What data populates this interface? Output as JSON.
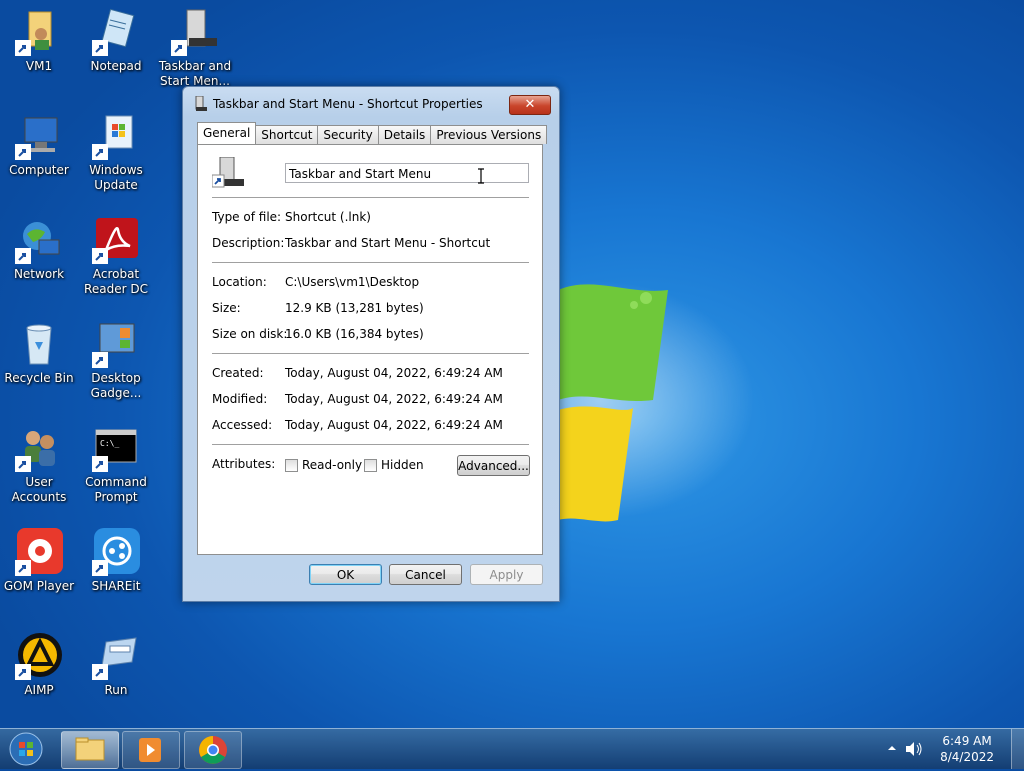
{
  "desktop": {
    "icons": [
      {
        "label": "VM1",
        "name": "vm1-folder"
      },
      {
        "label": "Notepad",
        "name": "notepad"
      },
      {
        "label": "Taskbar and Start Men...",
        "name": "taskbar-and-start-menu"
      },
      {
        "label": "Computer",
        "name": "computer"
      },
      {
        "label": "Windows Update",
        "name": "windows-update"
      },
      {
        "label": "Network",
        "name": "network"
      },
      {
        "label": "Acrobat Reader DC",
        "name": "acrobat-reader-dc"
      },
      {
        "label": "Recycle Bin",
        "name": "recycle-bin"
      },
      {
        "label": "Desktop Gadge...",
        "name": "desktop-gadgets"
      },
      {
        "label": "User Accounts",
        "name": "user-accounts"
      },
      {
        "label": "Command Prompt",
        "name": "command-prompt"
      },
      {
        "label": "GOM Player",
        "name": "gom-player"
      },
      {
        "label": "SHAREit",
        "name": "shareit"
      },
      {
        "label": "AIMP",
        "name": "aimp"
      },
      {
        "label": "Run",
        "name": "run"
      }
    ]
  },
  "dialog": {
    "title": "Taskbar and Start Menu - Shortcut Properties",
    "close_label": "✕",
    "tabs": [
      "General",
      "Shortcut",
      "Security",
      "Details",
      "Previous Versions"
    ],
    "active_tab": "General",
    "name_value": "Taskbar and Start Menu",
    "type_label": "Type of file:",
    "type_value": "Shortcut (.lnk)",
    "desc_label": "Description:",
    "desc_value": "Taskbar and Start Menu - Shortcut",
    "location_label": "Location:",
    "location_value": "C:\\Users\\vm1\\Desktop",
    "size_label": "Size:",
    "size_value": "12.9 KB (13,281 bytes)",
    "sizeondisk_label": "Size on disk:",
    "sizeondisk_value": "16.0 KB (16,384 bytes)",
    "created_label": "Created:",
    "created_value": "Today, August 04, 2022, 6:49:24 AM",
    "modified_label": "Modified:",
    "modified_value": "Today, August 04, 2022, 6:49:24 AM",
    "accessed_label": "Accessed:",
    "accessed_value": "Today, August 04, 2022, 6:49:24 AM",
    "attributes_label": "Attributes:",
    "readonly_label": "Read-only",
    "hidden_label": "Hidden",
    "advanced_label": "Advanced...",
    "ok_label": "OK",
    "cancel_label": "Cancel",
    "apply_label": "Apply"
  },
  "taskbar": {
    "time": "6:49 AM",
    "date": "8/4/2022",
    "items": [
      "file-explorer",
      "media-player",
      "chrome"
    ]
  }
}
